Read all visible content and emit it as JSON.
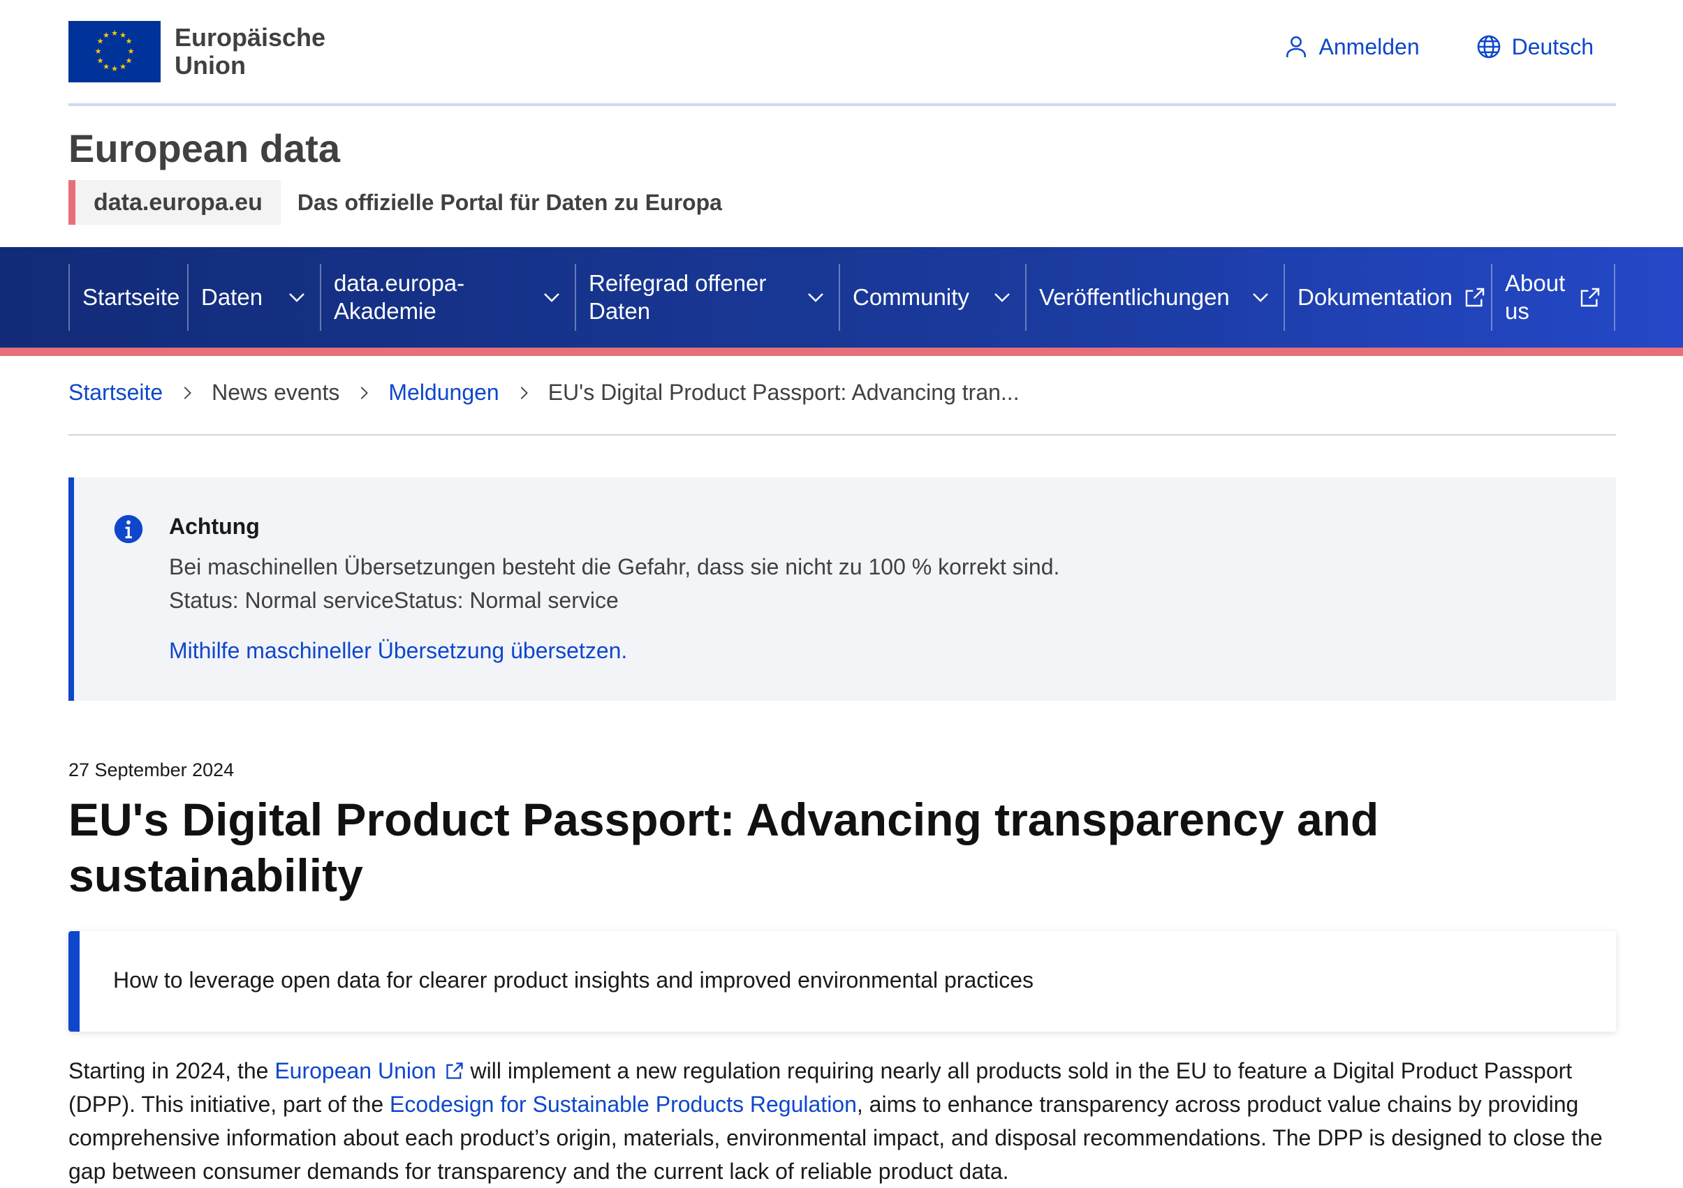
{
  "header": {
    "logo_line1": "Europäische",
    "logo_line2": "Union",
    "login_label": "Anmelden",
    "language_label": "Deutsch"
  },
  "site": {
    "title": "European data",
    "domain": "data.europa.eu",
    "tagline": "Das offizielle Portal für Daten zu Europa"
  },
  "nav": {
    "items": [
      {
        "line1": "Startseite",
        "line2": ""
      },
      {
        "line1": "Daten",
        "line2": ""
      },
      {
        "line1": "data.europa-",
        "line2": "Akademie"
      },
      {
        "line1": "Reifegrad offener",
        "line2": "Daten"
      },
      {
        "line1": "Community",
        "line2": ""
      },
      {
        "line1": "Veröffentlichungen",
        "line2": ""
      },
      {
        "line1": "Dokumentation",
        "line2": ""
      },
      {
        "line1": "About",
        "line2": "us"
      }
    ]
  },
  "breadcrumb": {
    "items": [
      "Startseite",
      "News events",
      "Meldungen",
      "EU's Digital Product Passport: Advancing tran..."
    ]
  },
  "notice": {
    "title": "Achtung",
    "text1": "Bei maschinellen Übersetzungen besteht die Gefahr, dass sie nicht zu 100 % korrekt sind.",
    "text2": "Status: Normal serviceStatus: Normal service",
    "link": "Mithilfe maschineller Übersetzung übersetzen."
  },
  "article": {
    "date": "27 September 2024",
    "title": "EU's Digital Product Passport: Advancing transparency and sustainability",
    "lead": "How to leverage open data for clearer product insights and improved environmental practices",
    "body_part1": "Starting in 2024, the ",
    "body_link1": "European Union",
    "body_part2": " will implement a new regulation requiring nearly all products sold in the EU to feature a Digital Product Passport (DPP). This initiative, part of the ",
    "body_link2": "Ecodesign for Sustainable Products Regulation",
    "body_part3": ", aims to enhance transparency across product value chains by providing comprehensive information about each product’s origin, materials, environmental impact, and disposal recommendations. The DPP is designed to close the gap between consumer demands for transparency and the current lack of reliable product data."
  },
  "colors": {
    "eu_blue": "#003399",
    "link_blue": "#0e47cb",
    "nav_start": "#122b78",
    "nav_end": "#2448c8",
    "accent_pink": "#e5707a",
    "notice_bg": "#f3f4f8"
  }
}
